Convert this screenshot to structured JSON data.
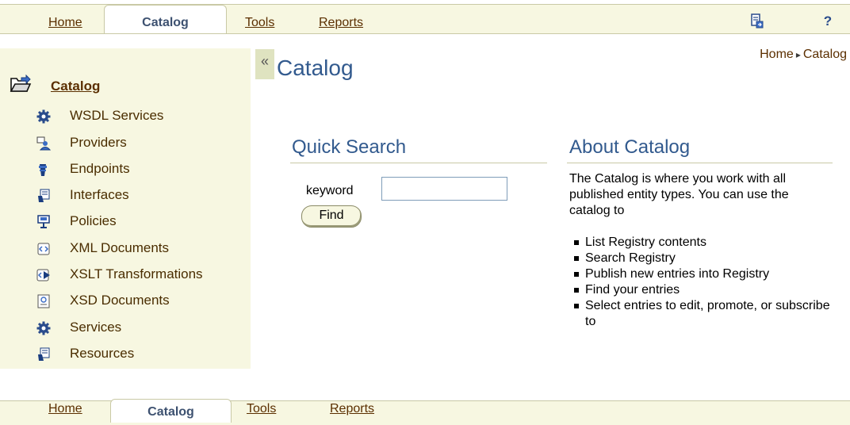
{
  "tabs_top": [
    {
      "label": "Home"
    },
    {
      "label": "Catalog"
    },
    {
      "label": "Tools"
    },
    {
      "label": "Reports"
    }
  ],
  "tabs_bottom": [
    {
      "label": "Home"
    },
    {
      "label": "Catalog"
    },
    {
      "label": "Tools"
    },
    {
      "label": "Reports"
    }
  ],
  "global_icons": {
    "help_label": "?",
    "export_icon": "document-export-icon"
  },
  "sidebar": {
    "title": "Catalog",
    "items": [
      {
        "label": "WSDL Services",
        "icon": "gear-icon"
      },
      {
        "label": "Providers",
        "icon": "providers-icon"
      },
      {
        "label": "Endpoints",
        "icon": "endpoint-icon"
      },
      {
        "label": "Interfaces",
        "icon": "interface-icon"
      },
      {
        "label": "Policies",
        "icon": "policy-icon"
      },
      {
        "label": "XML Documents",
        "icon": "xml-document-icon"
      },
      {
        "label": "XSLT Transformations",
        "icon": "xslt-icon"
      },
      {
        "label": "XSD Documents",
        "icon": "xsd-document-icon"
      },
      {
        "label": "Services",
        "icon": "gear-icon"
      },
      {
        "label": "Resources",
        "icon": "resource-icon"
      }
    ]
  },
  "main": {
    "collapse_glyph": "«",
    "title": "Catalog",
    "breadcrumb": {
      "home": "Home",
      "separator": "▸",
      "current": "Catalog"
    },
    "quick_search": {
      "heading": "Quick Search",
      "keyword_label": "keyword",
      "keyword_value": "",
      "find_label": "Find"
    },
    "about": {
      "heading": "About Catalog",
      "text": "The Catalog is where you work with all published entity types. You can use the catalog to",
      "items": [
        "List Registry contents",
        "Search Registry",
        "Publish new entries into Registry",
        "Find your entries",
        "Select entries to edit, promote, or subscribe to"
      ]
    }
  },
  "colors": {
    "heading_blue": "#325a8e",
    "link_brown": "#5b2f00",
    "panel_beige": "#f7f7e1",
    "border_khaki": "#c9c9a6"
  }
}
